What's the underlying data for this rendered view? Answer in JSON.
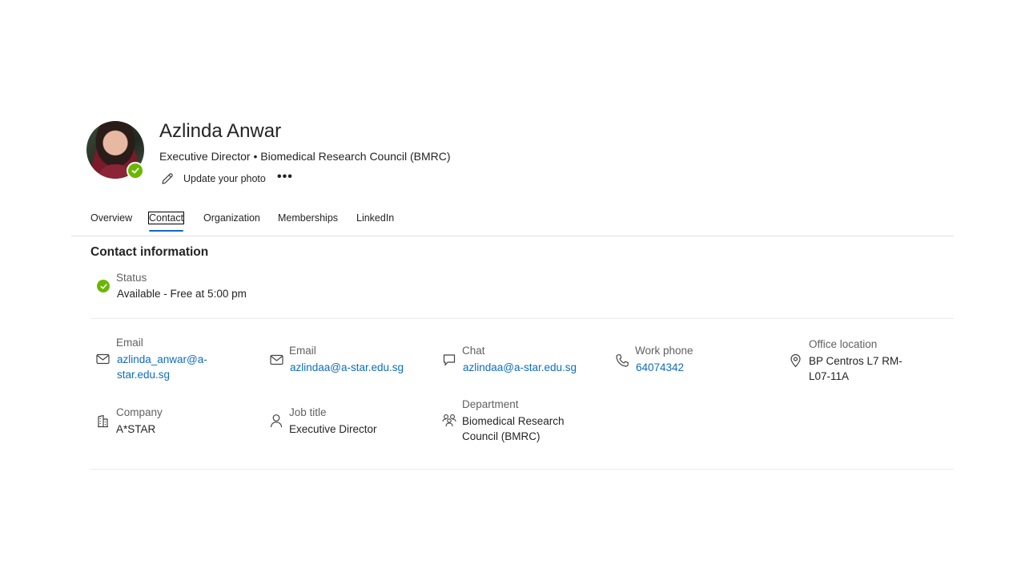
{
  "profile": {
    "name": "Azlinda Anwar",
    "subtitle": "Executive Director • Biomedical Research Council (BMRC)",
    "update_photo_label": "Update your photo",
    "more_label": "•••",
    "presence_color": "#6bb700"
  },
  "tabs": [
    {
      "label": "Overview"
    },
    {
      "label": "Contact",
      "active": true
    },
    {
      "label": "Organization"
    },
    {
      "label": "Memberships"
    },
    {
      "label": "LinkedIn"
    }
  ],
  "contact": {
    "title": "Contact information",
    "status": {
      "label": "Status",
      "value": "Available - Free at 5:00 pm"
    },
    "email1": {
      "label": "Email",
      "value_line1": "azlinda_anwar@a-",
      "value_line2": "star.edu.sg"
    },
    "email2": {
      "label": "Email",
      "value": "azlindaa@a-star.edu.sg"
    },
    "chat": {
      "label": "Chat",
      "value": "azlindaa@a-star.edu.sg"
    },
    "work_phone": {
      "label": "Work phone",
      "value": "64074342"
    },
    "office_location": {
      "label": "Office location",
      "value_line1": "BP Centros L7 RM-",
      "value_line2": "L07-11A"
    },
    "company": {
      "label": "Company",
      "value": "A*STAR"
    },
    "job_title": {
      "label": "Job title",
      "value": "Executive Director"
    },
    "department": {
      "label": "Department",
      "value_line1": "Biomedical Research",
      "value_line2": "Council (BMRC)"
    }
  },
  "colors": {
    "link": "#0f6cbd",
    "accent": "#0f6cbd",
    "available": "#6bb700"
  }
}
